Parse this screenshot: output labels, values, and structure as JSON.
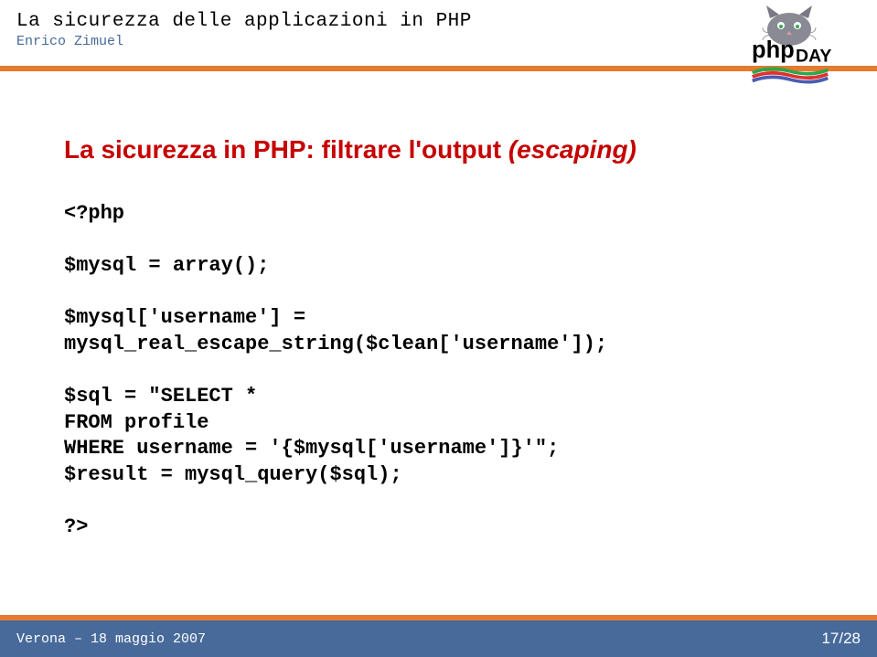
{
  "header": {
    "title": "La sicurezza delle applicazioni in PHP",
    "author": "Enrico Zimuel"
  },
  "logo": {
    "name": "phpDay",
    "text_php": "php",
    "text_day": "DAY"
  },
  "slide": {
    "title_pre": "La sicurezza in PHP: filtrare l'output ",
    "title_esc": "(escaping)",
    "code": "<?php\n\n$mysql = array();\n\n$mysql['username'] =\nmysql_real_escape_string($clean['username']);\n\n$sql = \"SELECT *\nFROM profile\nWHERE username = '{$mysql['username']}'\";\n$result = mysql_query($sql);\n\n?>"
  },
  "footer": {
    "location_date": "Verona – 18 maggio 2007",
    "page": "17/28"
  }
}
